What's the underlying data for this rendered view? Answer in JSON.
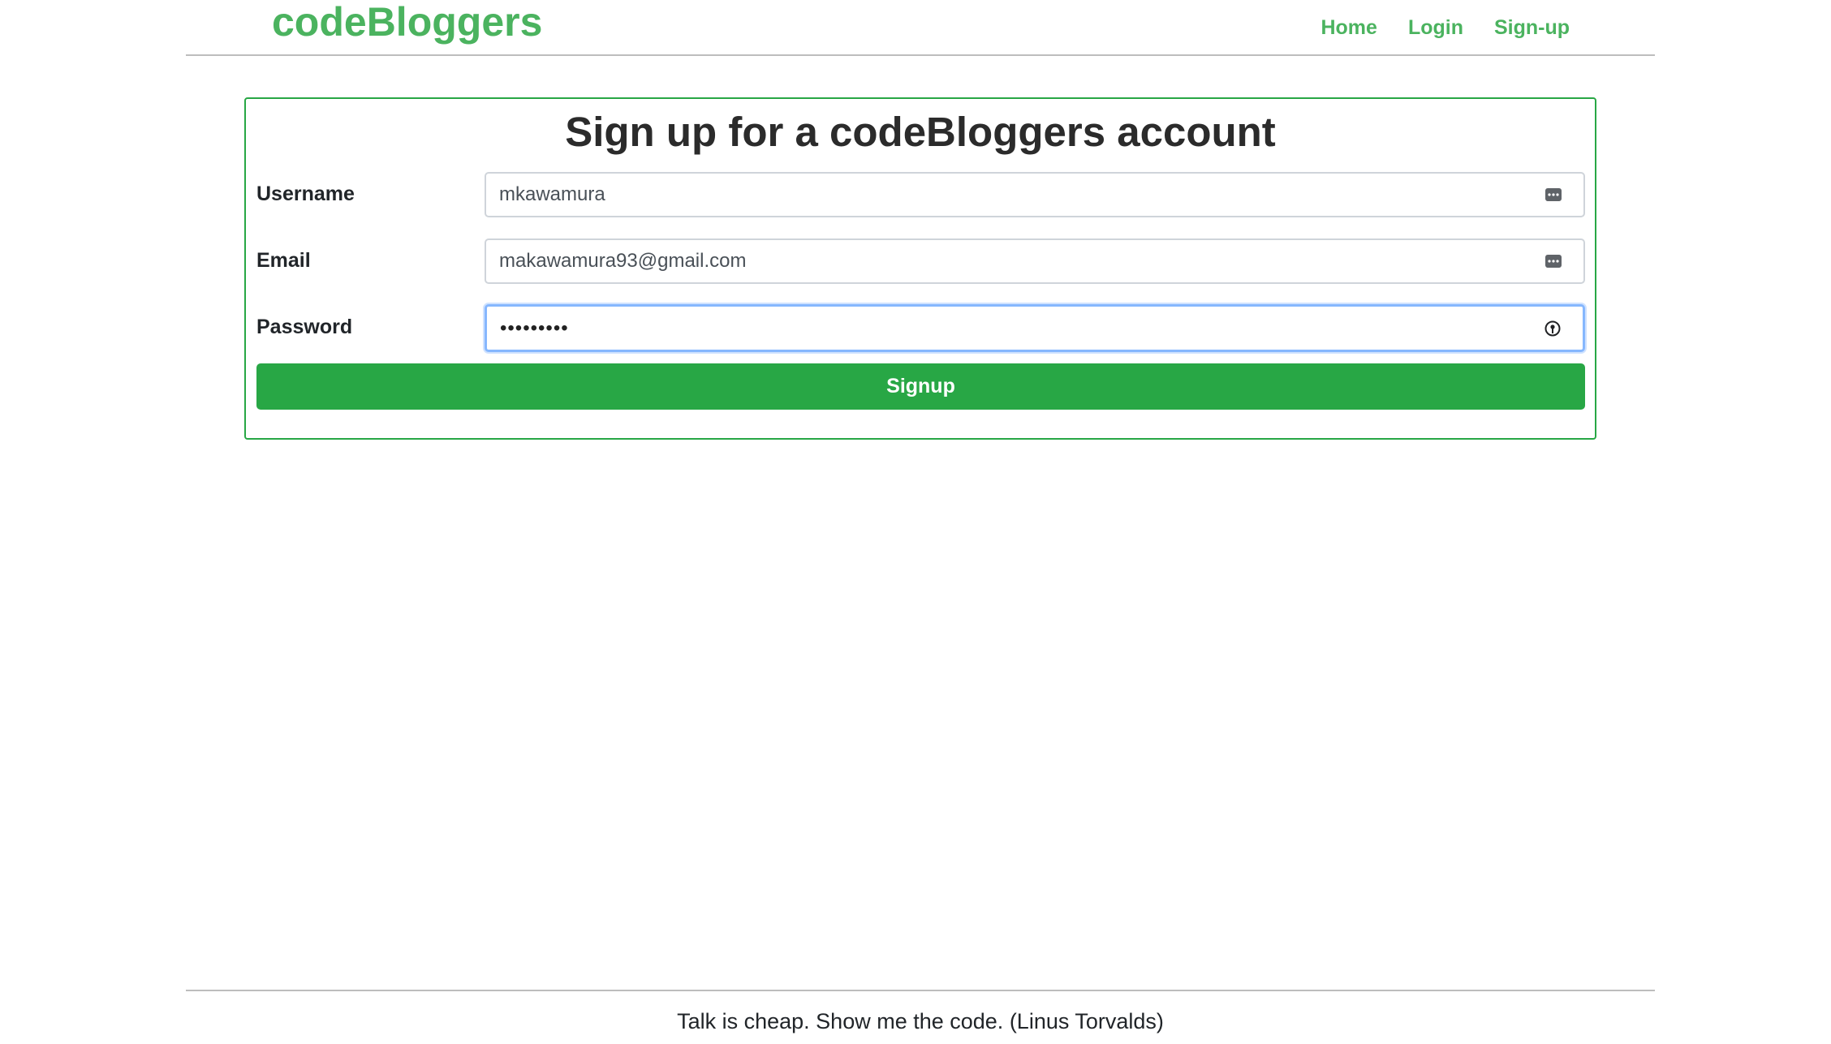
{
  "header": {
    "brand": "codeBloggers",
    "nav": [
      {
        "label": "Home"
      },
      {
        "label": "Login"
      },
      {
        "label": "Sign-up"
      }
    ]
  },
  "form": {
    "title": "Sign up for a codeBloggers account",
    "username": {
      "label": "Username",
      "value": "mkawamura",
      "icon": "autofill-dots-icon"
    },
    "email": {
      "label": "Email",
      "value": "makawamura93@gmail.com",
      "icon": "autofill-dots-icon"
    },
    "password": {
      "label": "Password",
      "value": "•••••••••",
      "icon": "password-key-icon"
    },
    "submit_label": "Signup"
  },
  "footer": {
    "quote": "Talk is cheap. Show me the code. (Linus Torvalds)"
  },
  "colors": {
    "brand_green": "#4bb35f",
    "button_green": "#28a745",
    "focus_blue": "#86b7fe"
  }
}
